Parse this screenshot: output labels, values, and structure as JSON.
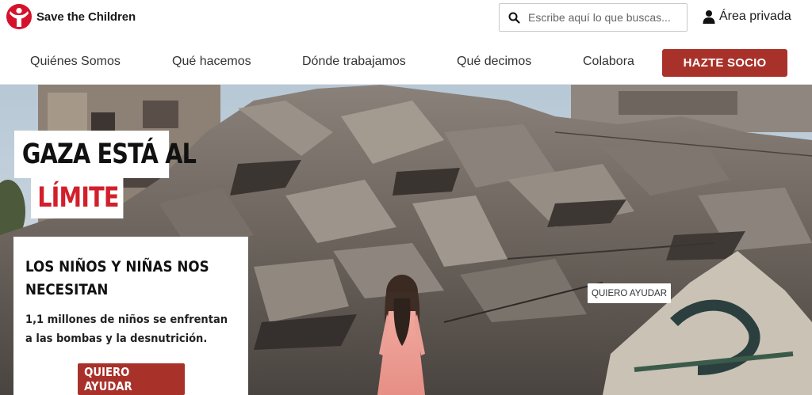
{
  "brand": {
    "name": "Save the Children",
    "color": "#d4122b",
    "icon": "save-the-children-logo"
  },
  "search": {
    "placeholder": "Escribe aquí lo que buscas...",
    "value": "",
    "icon": "search-icon"
  },
  "private_area": {
    "label": "Área privada",
    "icon": "user-icon"
  },
  "nav": {
    "items": [
      {
        "label": "Quiénes Somos"
      },
      {
        "label": "Qué hacemos"
      },
      {
        "label": "Dónde trabajamos"
      },
      {
        "label": "Qué decimos"
      },
      {
        "label": "Colabora"
      }
    ],
    "cta": {
      "label": "HAZTE SOCIO"
    }
  },
  "hero": {
    "headline_line1": "GAZA ESTÁ AL",
    "headline_line2": "LÍMITE",
    "headline_highlight_color": "#d21f2c",
    "card": {
      "title": "LOS NIÑOS Y NIÑAS NOS NECESITAN",
      "text": "1,1 millones de niños se enfrentan a las bombas y la desnutrición.",
      "button": "QUIERO AYUDAR"
    },
    "image_tag": "QUIERO AYUDAR"
  },
  "colors": {
    "accent": "#a8322a",
    "nav_text": "#333333"
  }
}
